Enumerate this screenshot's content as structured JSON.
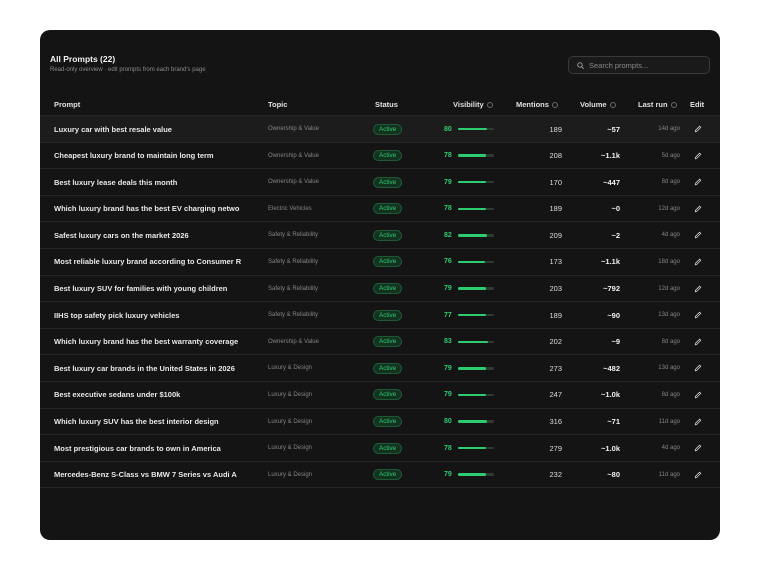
{
  "header": {
    "title": "All Prompts (22)",
    "subtitle": "Read-only overview · edit prompts from each brand's page"
  },
  "search": {
    "placeholder": "Search prompts..."
  },
  "columns": {
    "prompt": "Prompt",
    "topic": "Topic",
    "status": "Status",
    "visibility": "Visibility",
    "mentions": "Mentions",
    "volume": "Volume",
    "last_run": "Last run",
    "edit": "Edit"
  },
  "colors": {
    "background": "#141414",
    "accent": "#2ecc71"
  },
  "rows": [
    {
      "prompt": "Luxury car with best resale value",
      "topic": "Ownership & Value",
      "status": "Active",
      "visibility": 80,
      "mentions": "189",
      "volume": "~57",
      "last_run": "14d ago"
    },
    {
      "prompt": "Cheapest luxury brand to maintain long term",
      "topic": "Ownership & Value",
      "status": "Active",
      "visibility": 78,
      "mentions": "208",
      "volume": "~1.1k",
      "last_run": "5d ago"
    },
    {
      "prompt": "Best luxury lease deals this month",
      "topic": "Ownership & Value",
      "status": "Active",
      "visibility": 79,
      "mentions": "170",
      "volume": "~447",
      "last_run": "8d ago"
    },
    {
      "prompt": "Which luxury brand has the best EV charging netwo",
      "topic": "Electric Vehicles",
      "status": "Active",
      "visibility": 78,
      "mentions": "189",
      "volume": "~0",
      "last_run": "12d ago"
    },
    {
      "prompt": "Safest luxury cars on the market 2026",
      "topic": "Safety & Reliability",
      "status": "Active",
      "visibility": 82,
      "mentions": "209",
      "volume": "~2",
      "last_run": "4d ago"
    },
    {
      "prompt": "Most reliable luxury brand according to Consumer R",
      "topic": "Safety & Reliability",
      "status": "Active",
      "visibility": 76,
      "mentions": "173",
      "volume": "~1.1k",
      "last_run": "18d ago"
    },
    {
      "prompt": "Best luxury SUV for families with young children",
      "topic": "Safety & Reliability",
      "status": "Active",
      "visibility": 79,
      "mentions": "203",
      "volume": "~792",
      "last_run": "12d ago"
    },
    {
      "prompt": "IIHS top safety pick luxury vehicles",
      "topic": "Safety & Reliability",
      "status": "Active",
      "visibility": 77,
      "mentions": "189",
      "volume": "~90",
      "last_run": "13d ago"
    },
    {
      "prompt": "Which luxury brand has the best warranty coverage",
      "topic": "Ownership & Value",
      "status": "Active",
      "visibility": 83,
      "mentions": "202",
      "volume": "~9",
      "last_run": "8d ago"
    },
    {
      "prompt": "Best luxury car brands in the United States in 2026",
      "topic": "Luxury & Design",
      "status": "Active",
      "visibility": 79,
      "mentions": "273",
      "volume": "~482",
      "last_run": "13d ago"
    },
    {
      "prompt": "Best executive sedans under $100k",
      "topic": "Luxury & Design",
      "status": "Active",
      "visibility": 79,
      "mentions": "247",
      "volume": "~1.0k",
      "last_run": "8d ago"
    },
    {
      "prompt": "Which luxury SUV has the best interior design",
      "topic": "Luxury & Design",
      "status": "Active",
      "visibility": 80,
      "mentions": "316",
      "volume": "~71",
      "last_run": "11d ago"
    },
    {
      "prompt": "Most prestigious car brands to own in America",
      "topic": "Luxury & Design",
      "status": "Active",
      "visibility": 78,
      "mentions": "279",
      "volume": "~1.0k",
      "last_run": "4d ago"
    },
    {
      "prompt": "Mercedes-Benz S-Class vs BMW 7 Series vs Audi A",
      "topic": "Luxury & Design",
      "status": "Active",
      "visibility": 79,
      "mentions": "232",
      "volume": "~80",
      "last_run": "11d ago"
    }
  ]
}
